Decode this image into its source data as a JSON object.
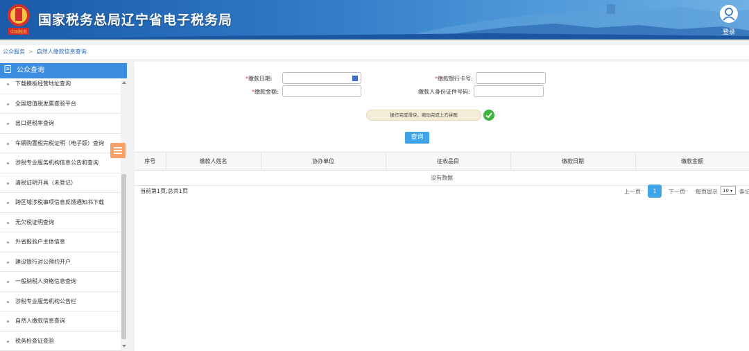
{
  "header": {
    "title": "国家税务总局辽宁省电子税务局",
    "login_label": "登录",
    "emblem_text": "中国税务"
  },
  "breadcrumb": {
    "home": "公众服务",
    "sep": ">",
    "current": "自然人缴款信息查询"
  },
  "sidebar": {
    "title": "公众查询",
    "items": [
      "下载模板经营地址查询",
      "全国增值税发票查验平台",
      "出口退税率查询",
      "车辆购置税完税证明（电子版）查询",
      "涉税专业服务机构信息公告和查询",
      "清税证明开具（未登记）",
      "跨区域涉税事项信息反馈通知书下载",
      "无欠税证明查询",
      "外省报验户主体信息",
      "建设银行对公预约开户",
      "一般纳税人资格信息查询",
      "涉税专业服务机构公告栏",
      "自然人缴款信息查询",
      "税务检查证查验"
    ]
  },
  "form": {
    "payment_date_label": "缴款日期:",
    "payment_amount_label": "缴款金额:",
    "bank_card_label": "缴款银行卡号:",
    "id_number_label": "缴款人身份证件号码:",
    "required_mark": "*",
    "payment_date_value": "",
    "payment_amount_value": "",
    "bank_card_value": "",
    "id_number_value": "",
    "captcha_text": "操作完成滑块，拖动完成上方拼图",
    "query_button": "查询"
  },
  "table": {
    "columns": [
      "序号",
      "缴款人姓名",
      "协办单位",
      "征收品目",
      "缴款日期",
      "缴款金额"
    ],
    "empty_text": "没有数据"
  },
  "pagination": {
    "summary": "当前第1页,总共1页",
    "prev": "上一页",
    "current_page": "1",
    "next": "下一页",
    "per_page_label": "每页显示",
    "per_page_value": "10",
    "per_page_suffix": "条记"
  },
  "colors": {
    "header_blue": "#2f79c6",
    "sidebar_head": "#3a8de0",
    "button_blue": "#3fa3e8",
    "toggle_orange": "#f7a06a",
    "success_green": "#3db53d"
  }
}
